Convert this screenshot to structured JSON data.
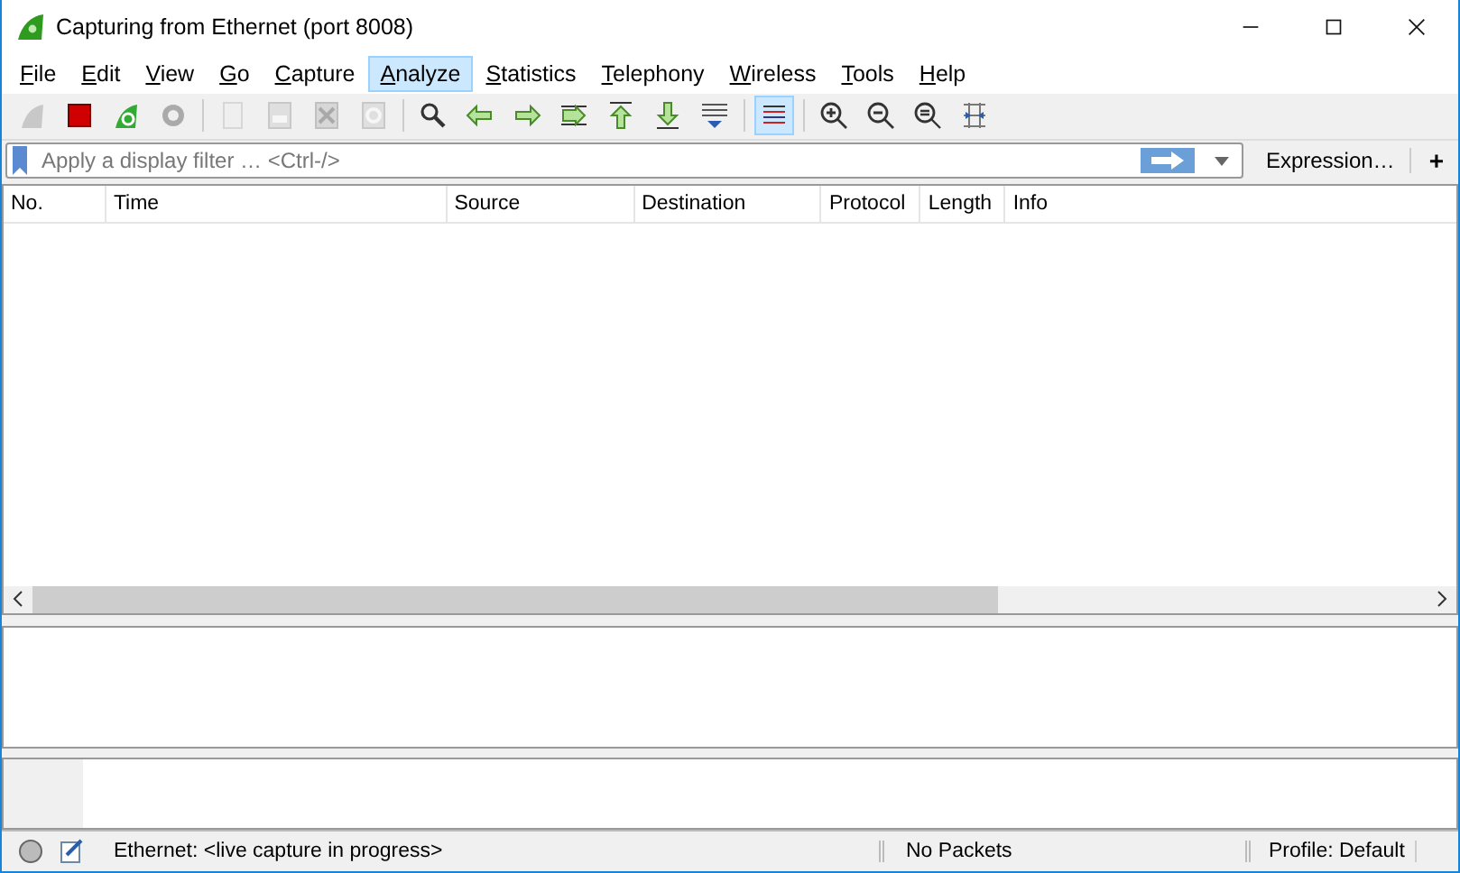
{
  "window": {
    "title": "Capturing from Ethernet (port 8008)"
  },
  "menu": [
    {
      "label": "File",
      "selected": false
    },
    {
      "label": "Edit",
      "selected": false
    },
    {
      "label": "View",
      "selected": false
    },
    {
      "label": "Go",
      "selected": false
    },
    {
      "label": "Capture",
      "selected": false
    },
    {
      "label": "Analyze",
      "selected": true
    },
    {
      "label": "Statistics",
      "selected": false
    },
    {
      "label": "Telephony",
      "selected": false
    },
    {
      "label": "Wireless",
      "selected": false
    },
    {
      "label": "Tools",
      "selected": false
    },
    {
      "label": "Help",
      "selected": false
    }
  ],
  "toolbar": [
    {
      "kind": "fin",
      "disabled": true
    },
    {
      "kind": "stop",
      "disabled": false
    },
    {
      "kind": "restart",
      "disabled": false
    },
    {
      "kind": "options",
      "disabled": false
    },
    {
      "kind": "sep"
    },
    {
      "kind": "file",
      "disabled": true
    },
    {
      "kind": "save",
      "disabled": true
    },
    {
      "kind": "close",
      "disabled": true
    },
    {
      "kind": "reload",
      "disabled": true
    },
    {
      "kind": "sep"
    },
    {
      "kind": "find",
      "disabled": false
    },
    {
      "kind": "back",
      "disabled": false
    },
    {
      "kind": "forward",
      "disabled": false
    },
    {
      "kind": "goto",
      "disabled": false
    },
    {
      "kind": "first",
      "disabled": false
    },
    {
      "kind": "last",
      "disabled": false
    },
    {
      "kind": "autoscroll",
      "disabled": false
    },
    {
      "kind": "sep"
    },
    {
      "kind": "colorize",
      "disabled": false,
      "selected": true
    },
    {
      "kind": "sep"
    },
    {
      "kind": "zoomin",
      "disabled": false
    },
    {
      "kind": "zoomout",
      "disabled": false
    },
    {
      "kind": "zoomreset",
      "disabled": false
    },
    {
      "kind": "resize",
      "disabled": false
    }
  ],
  "filter": {
    "placeholder": "Apply a display filter … <Ctrl-/>",
    "expression": "Expression…",
    "add": "+"
  },
  "table": {
    "columns": [
      "No.",
      "Time",
      "Source",
      "Destination",
      "Protocol",
      "Length",
      "Info"
    ]
  },
  "status_bar": {
    "interface": "Ethernet: <live capture in progress>",
    "packets": "No Packets",
    "profile": "Profile: Default"
  }
}
